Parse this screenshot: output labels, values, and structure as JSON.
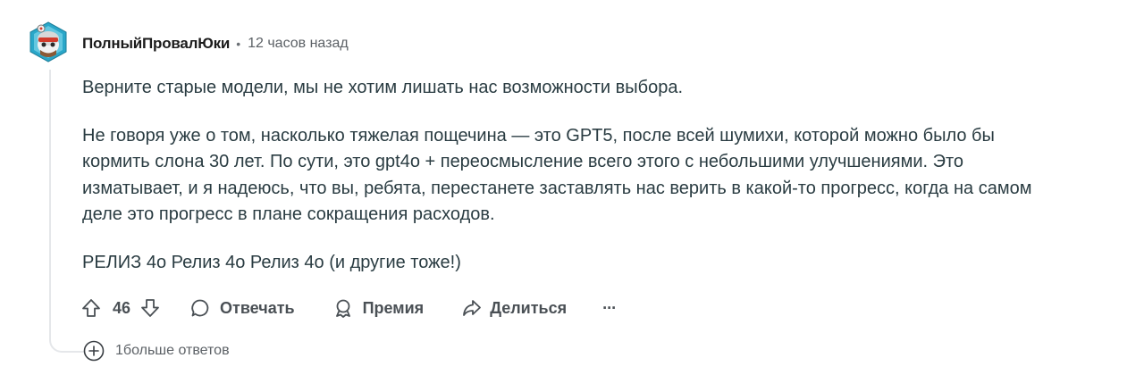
{
  "comment": {
    "author": "ПолныйПровалЮки",
    "separator": "•",
    "time": "12 часов назад",
    "paragraphs": [
      "Верните старые модели, мы не хотим лишать нас возможности выбора.",
      "Не говоря уже о том, насколько тяжелая пощечина — это GPT5, после всей шумихи, которой можно было бы кормить слона 30 лет. По сути, это gpt4o + переосмысление всего этого с небольшими улучшениями. Это изматывает, и я надеюсь, что вы, ребята, перестанете заставлять нас верить в какой-то прогресс, когда на самом деле это прогресс в плане сокращения расходов.",
      "РЕЛИЗ 4о Релиз 4о Релиз 4о (и другие тоже!)"
    ]
  },
  "actions": {
    "vote_count": "46",
    "reply_label": "Отвечать",
    "award_label": "Премия",
    "share_label": "Делиться",
    "more_label": "···"
  },
  "more_replies_label": "1больше ответов",
  "icons": {
    "upvote": "arrow-up-icon",
    "downvote": "arrow-down-icon",
    "reply": "speech-bubble-icon",
    "award": "award-icon",
    "share": "share-arrow-icon",
    "expand": "plus-circle-icon"
  },
  "colors": {
    "text": "#1c1c1c",
    "body_text": "#2a3c42",
    "muted": "#5c6166",
    "thread_line": "#e5e7ea"
  }
}
